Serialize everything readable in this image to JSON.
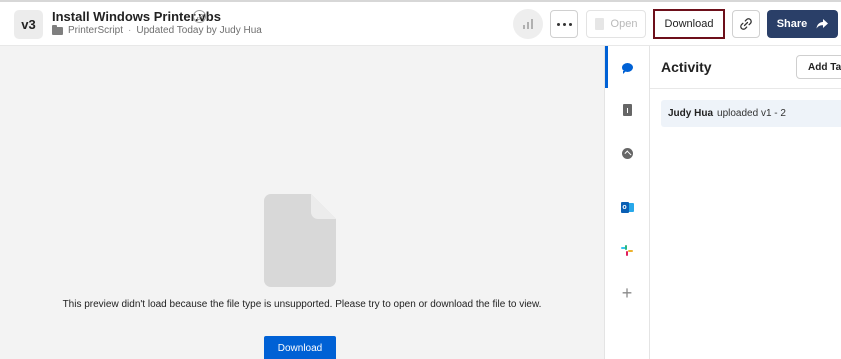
{
  "header": {
    "version": "v3",
    "file_name": "Install Windows Printer.vbs",
    "folder": "PrinterScript",
    "separator": "·",
    "updated": "Updated Today by Judy Hua",
    "open_label": "Open",
    "download_label": "Download",
    "share_label": "Share"
  },
  "preview": {
    "message": "This preview didn't load because the file type is unsupported. Please try to open or download the file to view.",
    "download_label": "Download"
  },
  "sidebar": {
    "title": "Activity",
    "add_task_label": "Add Ta",
    "entries": [
      {
        "user": "Judy Hua",
        "text": "uploaded v1 - 2"
      }
    ]
  },
  "rail": {
    "items": [
      "activity-icon",
      "details-icon",
      "sign-icon",
      "outlook-icon",
      "slack-icon",
      "add-icon"
    ],
    "active": "activity-icon"
  },
  "colors": {
    "accent": "#0061d5",
    "share": "#2a3f68",
    "download_border": "#6d0f1a"
  }
}
